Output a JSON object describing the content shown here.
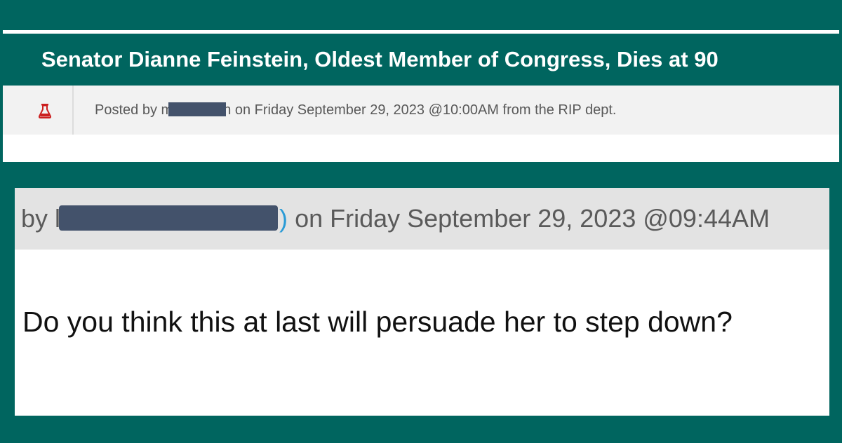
{
  "story": {
    "title": "Senator Dianne Feinstein, Oldest Member of Congress, Dies at 90",
    "posted_prefix": "Posted by",
    "author_partial_start": "m",
    "author_partial_end": "h",
    "posted_suffix": "on Friday September 29, 2023 @10:00AM from the RIP dept.",
    "topic_icon": "flask-icon"
  },
  "comment": {
    "by_prefix": "by",
    "author_partial_start": "l",
    "author_partial_end": ")",
    "timestamp": "on Friday September 29, 2023 @09:44AM",
    "body": "Do you think this at last will persuade her to step down?"
  },
  "colors": {
    "background": "#00655f",
    "redaction": "#43526b",
    "topic_icon": "#cc1f1f"
  }
}
